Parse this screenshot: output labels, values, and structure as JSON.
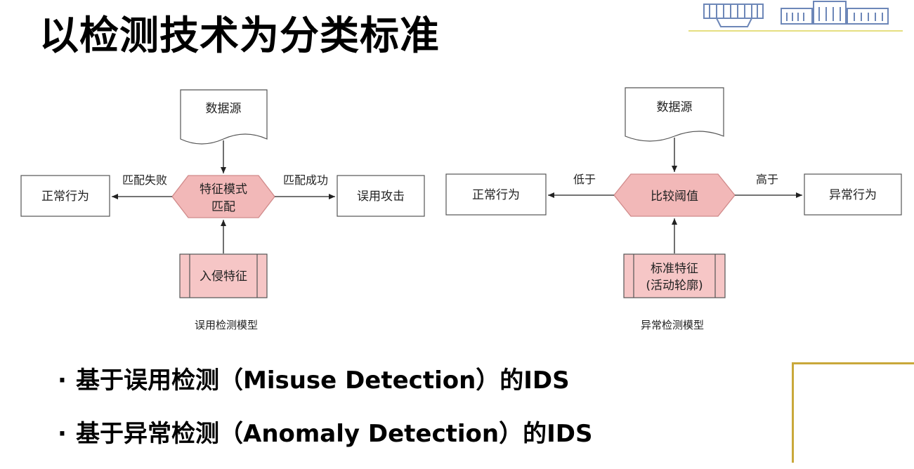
{
  "page": {
    "title": "以检测技术为分类标准"
  },
  "colors": {
    "accent_gold": "#c9a83a",
    "hexagon_fill": "#f2b8b8",
    "hexagon_stroke": "#d08a8a",
    "process_fill": "#f6c6c6",
    "logo_blue": "#6d87b8",
    "rule_yellow": "#e6df80"
  },
  "misuse_model": {
    "source": "数据源",
    "hexagon_line1": "特征模式",
    "hexagon_line2": "匹配",
    "left_box": "正常行为",
    "right_box": "误用攻击",
    "left_edge": "匹配失败",
    "right_edge": "匹配成功",
    "bottom_box": "入侵特征",
    "caption": "误用检测模型"
  },
  "anomaly_model": {
    "source": "数据源",
    "hexagon": "比较阈值",
    "left_box": "正常行为",
    "right_box": "异常行为",
    "left_edge": "低于",
    "right_edge": "高于",
    "bottom_line1": "标准特征",
    "bottom_line2": "(活动轮廓)",
    "caption": "异常检测模型"
  },
  "bullets": [
    "基于误用检测（Misuse Detection）的IDS",
    "基于异常检测（Anomaly Detection）的IDS"
  ]
}
